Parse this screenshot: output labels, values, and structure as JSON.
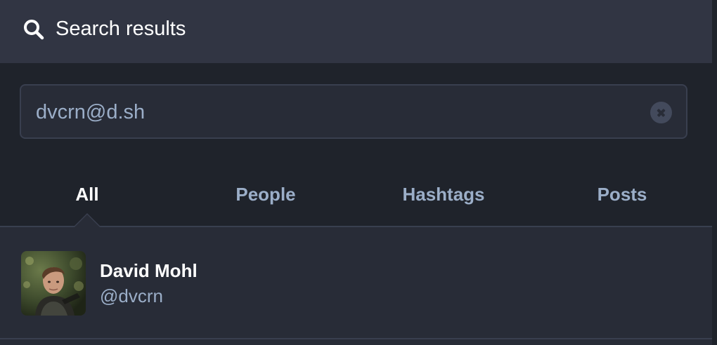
{
  "header": {
    "title": "Search results",
    "icon": "search-icon"
  },
  "search": {
    "value": "dvcrn@d.sh",
    "clear_icon": "clear-icon"
  },
  "tabs": [
    {
      "label": "All",
      "active": true
    },
    {
      "label": "People",
      "active": false
    },
    {
      "label": "Hashtags",
      "active": false
    },
    {
      "label": "Posts",
      "active": false
    }
  ],
  "results": [
    {
      "display_name": "David Mohl",
      "acct": "@dvcrn"
    }
  ],
  "colors": {
    "header_bg": "#313543",
    "panel_bg": "#1f232b",
    "content_bg": "#282c37",
    "muted_text": "#9baec8",
    "border": "#393f4f"
  }
}
